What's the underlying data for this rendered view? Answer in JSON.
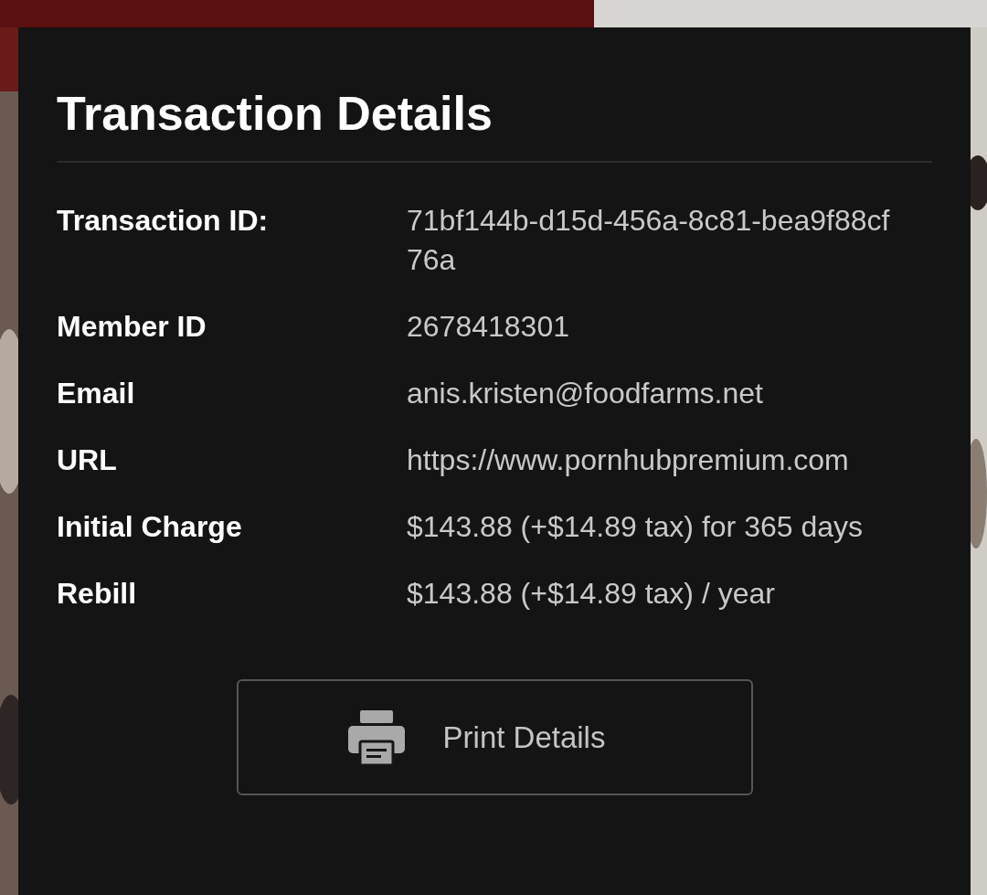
{
  "panel": {
    "title": "Transaction Details",
    "rows": [
      {
        "label": "Transaction ID:",
        "value": "71bf144b-d15d-456a-8c81-bea9f88cf76a"
      },
      {
        "label": "Member ID",
        "value": "2678418301"
      },
      {
        "label": "Email",
        "value": "anis.kristen@foodfarms.net"
      },
      {
        "label": "URL",
        "value": "https://www.pornhubpremium.com"
      },
      {
        "label": "Initial Charge",
        "value": "$143.88 (+$14.89 tax) for 365 days"
      },
      {
        "label": "Rebill",
        "value": "$143.88 (+$14.89 tax) / year"
      }
    ],
    "button": {
      "label": "Print Details"
    }
  }
}
